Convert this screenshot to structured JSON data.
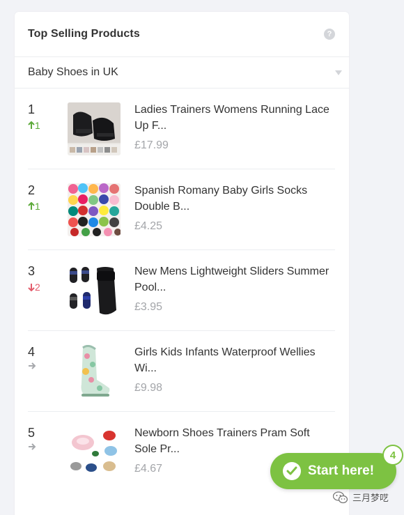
{
  "widget": {
    "title": "Top Selling Products",
    "help_icon": "question-mark-icon",
    "category_select": {
      "value": "Baby Shoes in UK",
      "icon": "caret-down-icon"
    }
  },
  "products": [
    {
      "rank": "1",
      "change": "1",
      "direction": "up",
      "title": "Ladies Trainers Womens Running Lace Up F...",
      "price": "£17.99"
    },
    {
      "rank": "2",
      "change": "1",
      "direction": "up",
      "title": "Spanish Romany Baby Girls Socks Double B...",
      "price": "£4.25"
    },
    {
      "rank": "3",
      "change": "2",
      "direction": "down",
      "title": "New Mens Lightweight Sliders Summer Pool...",
      "price": "£3.95"
    },
    {
      "rank": "4",
      "change": "",
      "direction": "same",
      "title": "Girls Kids Infants Waterproof Wellies Wi...",
      "price": "£9.98"
    },
    {
      "rank": "5",
      "change": "",
      "direction": "same",
      "title": "Newborn Shoes Trainers Pram Soft Sole Pr...",
      "price": "£4.67"
    }
  ],
  "cta": {
    "label": "Start here!",
    "badge": "4",
    "icon": "check-circle-icon"
  },
  "watermark": {
    "text": "三月梦呓",
    "icon": "wechat-icon"
  },
  "colors": {
    "up": "#5daa3b",
    "down": "#e35b6b",
    "flat": "#a7a9ad",
    "cta": "#7dc242",
    "price": "#a3a5a9"
  }
}
